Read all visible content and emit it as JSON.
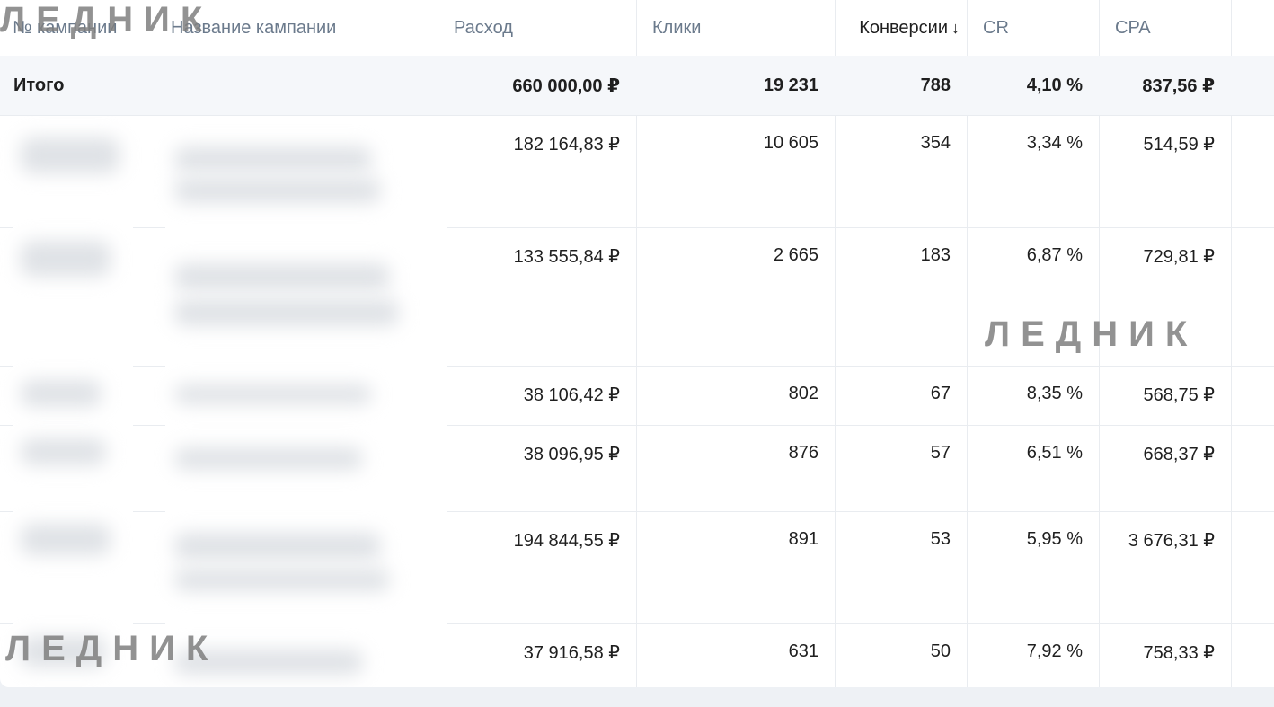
{
  "columns": {
    "campaign_no": "№ кампании",
    "campaign_name": "Название кампании",
    "spend": "Расход",
    "clicks": "Клики",
    "conversions": "Конверсии",
    "cr": "CR",
    "cpa": "CPA"
  },
  "sort_icon": "arrow-down",
  "total": {
    "label": "Итого",
    "spend": "660 000,00 ₽",
    "clicks": "19 231",
    "conversions": "788",
    "cr": "4,10 %",
    "cpa": "837,56 ₽"
  },
  "rows": [
    {
      "spend": "182 164,83 ₽",
      "clicks": "10 605",
      "conversions": "354",
      "cr": "3,34 %",
      "cpa": "514,59 ₽"
    },
    {
      "spend": "133 555,84 ₽",
      "clicks": "2 665",
      "conversions": "183",
      "cr": "6,87 %",
      "cpa": "729,81 ₽"
    },
    {
      "spend": "38 106,42 ₽",
      "clicks": "802",
      "conversions": "67",
      "cr": "8,35 %",
      "cpa": "568,75 ₽"
    },
    {
      "spend": "38 096,95 ₽",
      "clicks": "876",
      "conversions": "57",
      "cr": "6,51 %",
      "cpa": "668,37 ₽"
    },
    {
      "spend": "194 844,55 ₽",
      "clicks": "891",
      "conversions": "53",
      "cr": "5,95 %",
      "cpa": "3 676,31 ₽"
    },
    {
      "spend": "37 916,58 ₽",
      "clicks": "631",
      "conversions": "50",
      "cr": "7,92 %",
      "cpa": "758,33 ₽"
    }
  ],
  "watermark": "ЛЕДНИК"
}
